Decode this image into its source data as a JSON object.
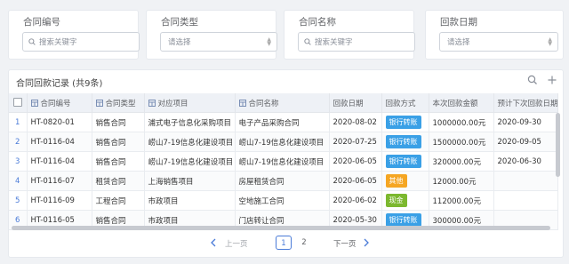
{
  "filters": [
    {
      "label": "合同编号",
      "placeholder": "搜索关键字",
      "type": "search"
    },
    {
      "label": "合同类型",
      "placeholder": "请选择",
      "type": "select"
    },
    {
      "label": "合同名称",
      "placeholder": "搜索关键字",
      "type": "search"
    },
    {
      "label": "回款日期",
      "placeholder": "请选择",
      "type": "select"
    }
  ],
  "table": {
    "title": "合同回款记录 (共9条)",
    "columns": [
      "合同编号",
      "合同类型",
      "对应项目",
      "合同名称",
      "回款日期",
      "回款方式",
      "本次回款金额",
      "预计下次回款日期"
    ],
    "rows": [
      {
        "idx": "1",
        "code": "HT-0820-01",
        "type": "销售合同",
        "project": "浦式电子信息化采购项目",
        "name": "电子产品采购合同",
        "date": "2020-08-02",
        "method": "银行转账",
        "method_color": "#3aa0e6",
        "amount": "1000000.00元",
        "next": "2020-09-30"
      },
      {
        "idx": "2",
        "code": "HT-0116-04",
        "type": "销售合同",
        "project": "崂山7-19信息化建设项目",
        "name": "崂山7-19信息化建设项目",
        "date": "2020-07-25",
        "method": "银行转账",
        "method_color": "#3aa0e6",
        "amount": "1500000.00元",
        "next": "2020-09-05"
      },
      {
        "idx": "3",
        "code": "HT-0116-04",
        "type": "销售合同",
        "project": "崂山7-19信息化建设项目",
        "name": "崂山7-19信息化建设项目",
        "date": "2020-06-05",
        "method": "银行转账",
        "method_color": "#3aa0e6",
        "amount": "320000.00元",
        "next": "2020-06-30"
      },
      {
        "idx": "4",
        "code": "HT-0116-07",
        "type": "租赁合同",
        "project": "上海销售项目",
        "name": "房屋租赁合同",
        "date": "2020-06-05",
        "method": "其他",
        "method_color": "#f5a623",
        "amount": "12000.00元",
        "next": ""
      },
      {
        "idx": "5",
        "code": "HT-0116-09",
        "type": "工程合同",
        "project": "市政项目",
        "name": "空地施工合同",
        "date": "2020-06-02",
        "method": "现金",
        "method_color": "#7cb82f",
        "amount": "112000.00元",
        "next": ""
      },
      {
        "idx": "6",
        "code": "HT-0116-05",
        "type": "销售合同",
        "project": "市政项目",
        "name": "门店转让合同",
        "date": "2020-05-30",
        "method": "银行转账",
        "method_color": "#3aa0e6",
        "amount": "300000.00元",
        "next": ""
      }
    ]
  },
  "pagination": {
    "prev": "上一页",
    "pages": [
      "1",
      "2"
    ],
    "current": "1",
    "next": "下一页"
  },
  "icons": {
    "search": "search-icon",
    "add": "plus-icon",
    "column": "table-column-icon"
  },
  "colors": {
    "accent": "#4a7bd8",
    "bank": "#3aa0e6",
    "other": "#f5a623",
    "cash": "#7cb82f"
  }
}
